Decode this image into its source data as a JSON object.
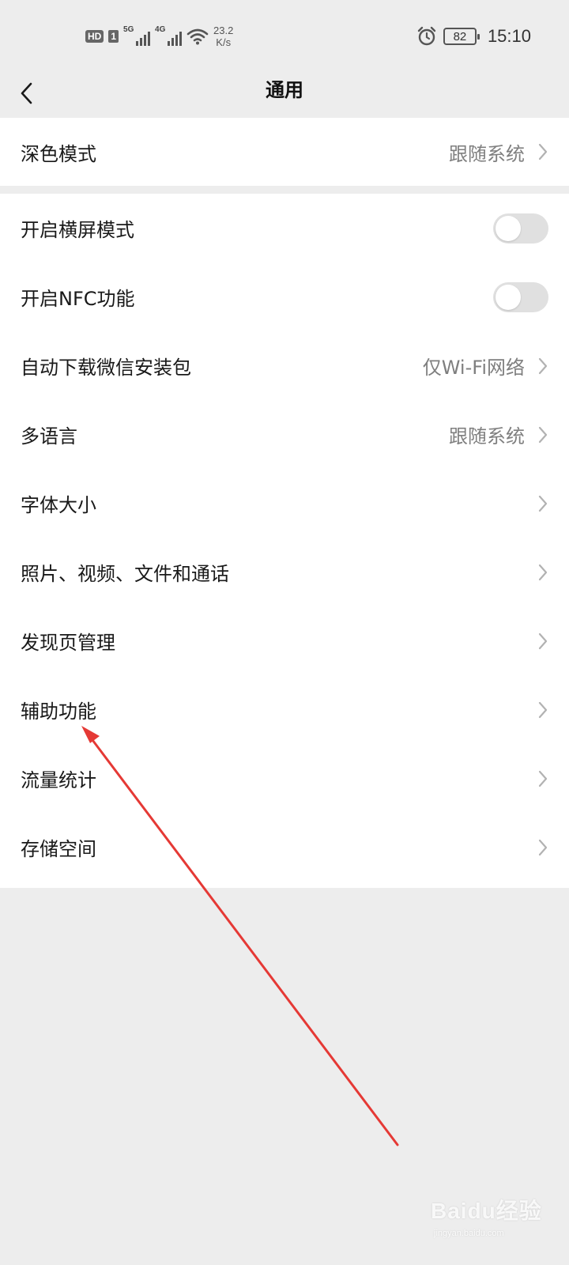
{
  "status_bar": {
    "hd": "HD",
    "sim": "1",
    "net1": "5G",
    "net2": "4G",
    "speed_value": "23.2",
    "speed_unit": "K/s",
    "battery": "82",
    "time": "15:10"
  },
  "nav": {
    "title": "通用"
  },
  "group1": [
    {
      "label": "深色模式",
      "value": "跟随系统"
    }
  ],
  "group2": [
    {
      "label": "开启横屏模式",
      "toggle": false
    },
    {
      "label": "开启NFC功能",
      "toggle": false
    },
    {
      "label": "自动下载微信安装包",
      "value": "仅Wi-Fi网络"
    },
    {
      "label": "多语言",
      "value": "跟随系统"
    },
    {
      "label": "字体大小",
      "value": ""
    },
    {
      "label": "照片、视频、文件和通话",
      "value": ""
    },
    {
      "label": "发现页管理",
      "value": ""
    },
    {
      "label": "辅助功能",
      "value": ""
    },
    {
      "label": "流量统计",
      "value": ""
    },
    {
      "label": "存储空间",
      "value": ""
    }
  ],
  "watermark": {
    "text": "Baidu经验",
    "sub": "jingyan.baidu.com"
  },
  "colors": {
    "background": "#ededed",
    "card": "#ffffff",
    "annotation_arrow": "#e53935",
    "secondary_text": "#7f7f7f"
  }
}
